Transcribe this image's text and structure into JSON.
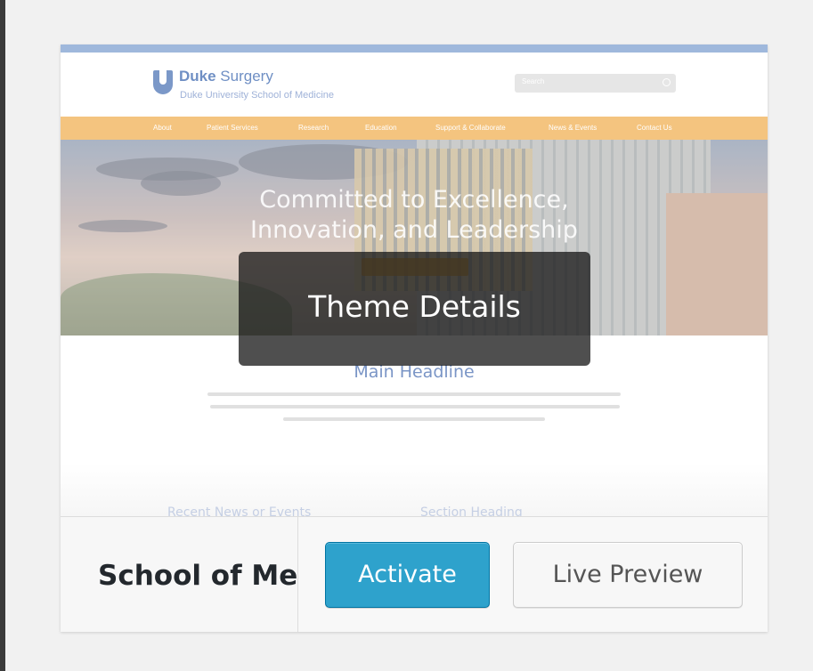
{
  "theme": {
    "name": "School of Medicine",
    "details_label": "Theme Details",
    "actions": {
      "activate_label": "Activate",
      "preview_label": "Live Preview"
    }
  },
  "preview": {
    "logo_brand": "Duke",
    "logo_product": " Surgery",
    "logo_subtitle": "Duke University School of Medicine",
    "search_placeholder": "Search",
    "nav": [
      "About",
      "Patient Services",
      "Research",
      "Education",
      "Support & Collaborate",
      "News & Events",
      "Contact Us"
    ],
    "hero_line_1": "Committed to Excellence,",
    "hero_line_2": "Innovation, and Leadership",
    "main_headline": "Main Headline",
    "recent_heading": "Recent News or Events",
    "section_heading": "Section Heading"
  },
  "colors": {
    "accent": "#2ea2cc",
    "nav_bar": "#f4c47f",
    "brand_blue": "#7a95c6"
  }
}
